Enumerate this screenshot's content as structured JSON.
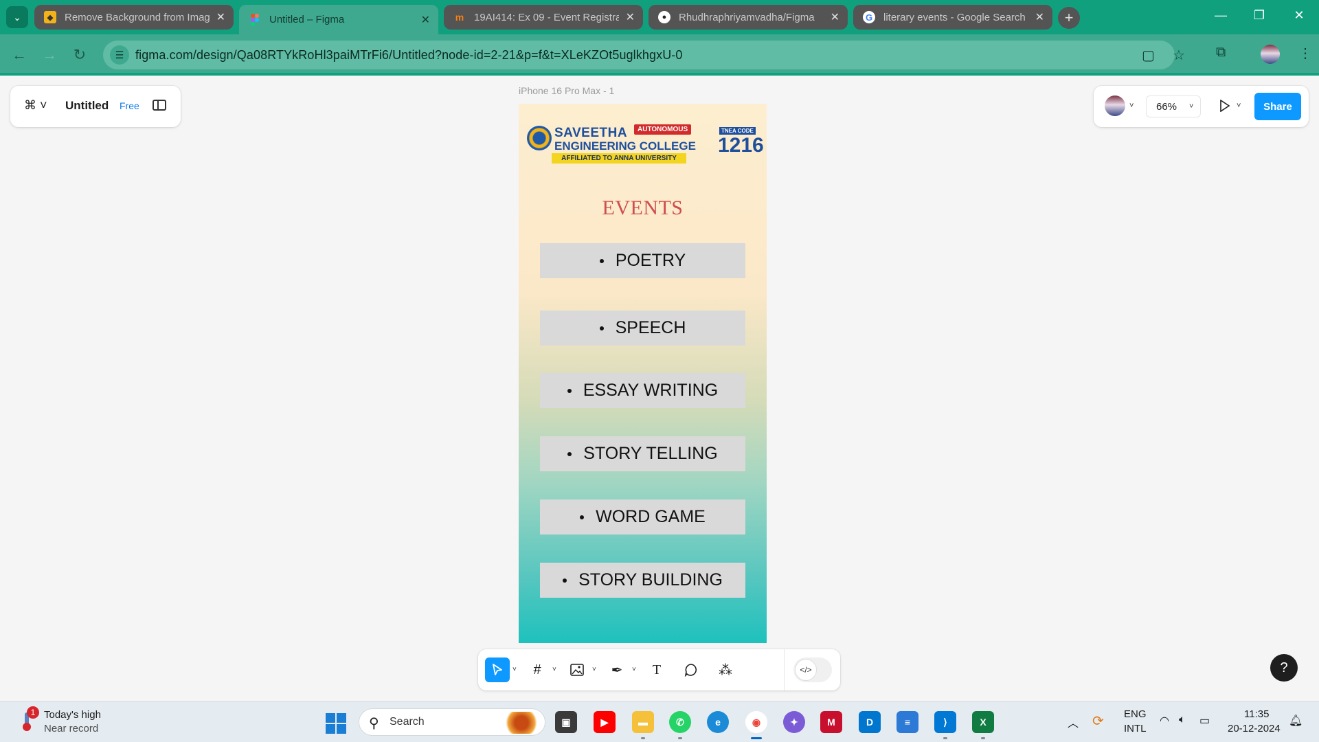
{
  "browser": {
    "tabs": [
      {
        "title": "Remove Background from Imag",
        "favicon": "remove-bg-favicon",
        "color": "#f2b21a"
      },
      {
        "title": "Untitled – Figma",
        "favicon": "figma-favicon",
        "color": "#f24e1e"
      },
      {
        "title": "19AI414: Ex 09 - Event Registrat",
        "favicon": "moodle-favicon",
        "color": "#f98012"
      },
      {
        "title": "Rhudhraphriyamvadha/Figma",
        "favicon": "github-favicon",
        "color": "#ffffff"
      },
      {
        "title": "literary events - Google Search",
        "favicon": "google-favicon",
        "color": "#4285f4"
      }
    ],
    "url": "figma.com/design/Qa08RTYkRoHl3paiMTrFi6/Untitled?node-id=2-21&p=f&t=XLeKZOt5uglkhgxU-0"
  },
  "figma": {
    "file_title": "Untitled",
    "plan_badge": "Free",
    "zoom": "66%",
    "share_label": "Share",
    "frame_label": "iPhone 16 Pro Max - 1",
    "help_label": "?"
  },
  "design": {
    "logo": {
      "line1": "SAVEETHA",
      "line2": "ENGINEERING COLLEGE",
      "autonomous": "AUTONOMOUS",
      "affiliated": "AFFILIATED TO ANNA UNIVERSITY",
      "tnea": "TNEA CODE",
      "code": "1216"
    },
    "title": "EVENTS",
    "events": [
      "POETRY",
      "SPEECH",
      "ESSAY WRITING",
      "STORY TELLING",
      "WORD GAME",
      "STORY BUILDING"
    ]
  },
  "taskbar": {
    "weather_title": "Today's high",
    "weather_sub": "Near record",
    "weather_badge": "1",
    "search_placeholder": "Search",
    "lang_line1": "ENG",
    "lang_line2": "INTL",
    "time": "11:35",
    "date": "20-12-2024"
  },
  "colors": {
    "browser_frame": "#11a07e",
    "figma_blue": "#0d99ff",
    "events_title": "#cf4d4f",
    "event_box": "#d9d9d9"
  }
}
